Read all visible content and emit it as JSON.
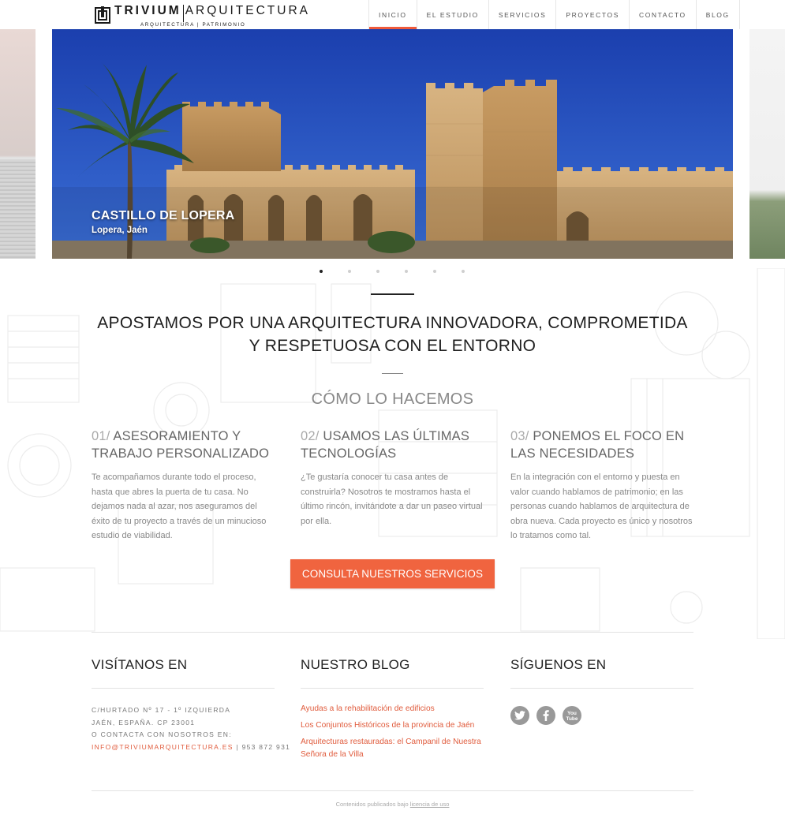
{
  "header": {
    "logo": {
      "name_bold": "TRIVIUM",
      "name_light": "ARQUITECTURA",
      "tagline_left": "ARQUITECTURA",
      "tagline_right": "PATRIMONIO"
    },
    "nav": [
      {
        "label": "INICIO",
        "active": true
      },
      {
        "label": "EL ESTUDIO",
        "active": false
      },
      {
        "label": "SERVICIOS",
        "active": false
      },
      {
        "label": "PROYECTOS",
        "active": false
      },
      {
        "label": "CONTACTO",
        "active": false
      },
      {
        "label": "BLOG",
        "active": false
      }
    ]
  },
  "slider": {
    "title": "CASTILLO DE LOPERA",
    "subtitle": "Lopera, Jaén",
    "dot_count": 6,
    "active_dot": 1
  },
  "intro": {
    "headline_line1": "APOSTAMOS POR UNA ARQUITECTURA INNOVADORA, COMPROMETIDA",
    "headline_line2": "Y RESPETUOSA CON EL ENTORNO",
    "section_title": "CÓMO LO HACEMOS"
  },
  "features": [
    {
      "num": "01/",
      "title_line1": " ASESORAMIENTO Y",
      "title_line2": "TRABAJO PERSONALIZADO",
      "text": "Te acompañamos durante todo el proceso, hasta que abres la puerta de tu casa. No dejamos nada al azar, nos aseguramos del éxito de tu proyecto a través de un minucioso estudio de viabilidad."
    },
    {
      "num": "02/",
      "title_line1": " USAMOS LAS ÚLTIMAS",
      "title_line2": "TECNOLOGÍAS",
      "text": "¿Te gustaría conocer tu casa antes de construirla? Nosotros te mostramos hasta el último rincón, invitándote a dar un paseo virtual por ella."
    },
    {
      "num": "03/",
      "title_line1": " PONEMOS EL FOCO EN",
      "title_line2": "LAS NECESIDADES",
      "text": "En la integración con el entorno y puesta en valor cuando hablamos de patrimonio; en las personas cuando hablamos de arquitectura de obra nueva. Cada proyecto es único y nosotros lo tratamos como tal."
    }
  ],
  "cta": {
    "label": "CONSULTA NUESTROS SERVICIOS"
  },
  "footer": {
    "visit_title": "VISÍTANOS EN",
    "address_line1": "C/HURTADO Nº 17 - 1º IZQUIERDA",
    "address_line2": "JAÉN, ESPAÑA. CP 23001",
    "address_line3": "O CONTACTA CON NOSOTROS EN:",
    "email": "INFO@TRIVIUMARQUITECTURA.ES",
    "phone": " | 953 872 931",
    "blog_title": "NUESTRO BLOG",
    "blog_posts": [
      "Ayudas a la rehabilitación de edificios",
      "Los Conjuntos Históricos de la provincia de Jaén",
      "Arquitecturas restauradas: el Campanil de Nuestra Señora de la Villa"
    ],
    "follow_title": "SÍGUENOS EN",
    "social": [
      {
        "icon": "twitter-icon"
      },
      {
        "icon": "facebook-icon"
      },
      {
        "icon": "youtube-icon",
        "label": "You Tube"
      }
    ],
    "legal_text": "Contenidos publicados bajo ",
    "legal_link": "licencia de uso"
  },
  "colors": {
    "accent": "#f05a3a",
    "link": "#e05b3c",
    "sky": "#1f47b8",
    "stone": "#c9a26e"
  }
}
